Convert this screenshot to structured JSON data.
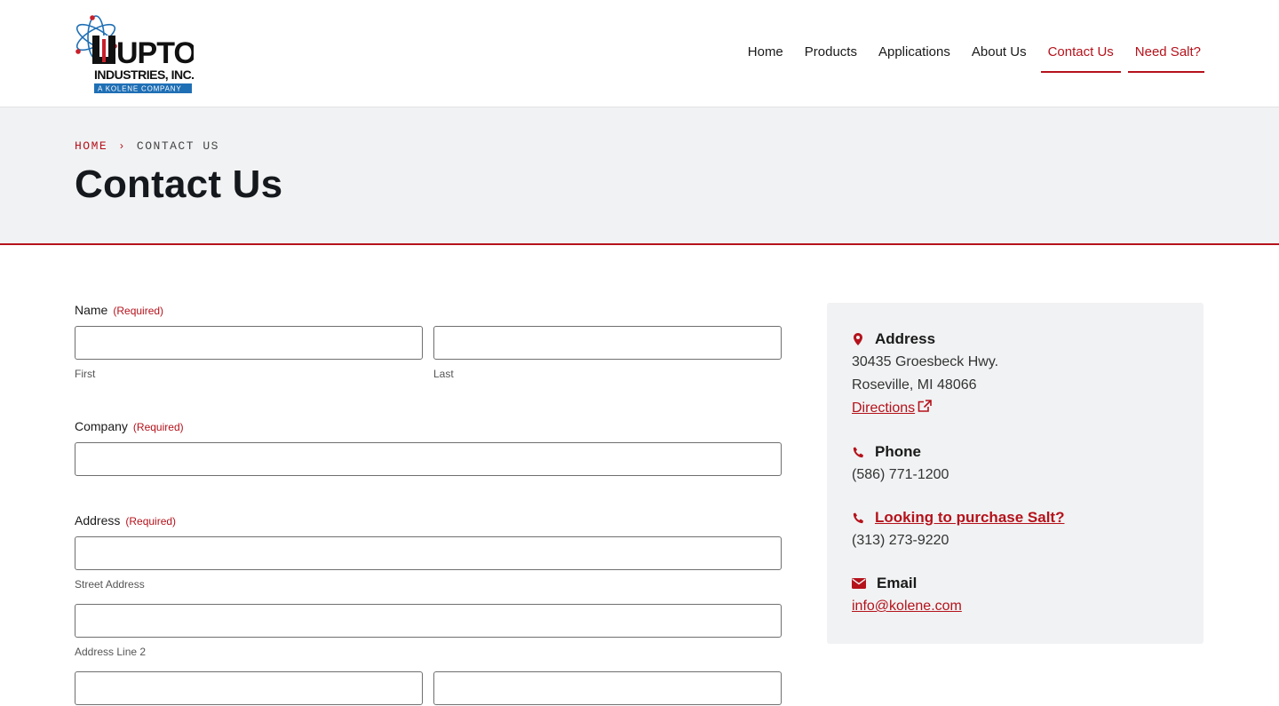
{
  "logo": {
    "text_main": "UPTON",
    "text_sub": "INDUSTRIES, INC.",
    "text_tag": "A KOLENE COMPANY"
  },
  "nav": [
    {
      "label": "Home"
    },
    {
      "label": "Products"
    },
    {
      "label": "Applications"
    },
    {
      "label": "About Us"
    },
    {
      "label": "Contact Us"
    },
    {
      "label": "Need Salt?"
    }
  ],
  "breadcrumb": {
    "home": "HOME",
    "separator": "›",
    "current": "CONTACT US"
  },
  "page_title": "Contact Us",
  "form": {
    "required_text": "(Required)",
    "name": {
      "label": "Name",
      "first_sub": "First",
      "last_sub": "Last"
    },
    "company": {
      "label": "Company"
    },
    "address": {
      "label": "Address",
      "street_sub": "Street Address",
      "line2_sub": "Address Line 2"
    }
  },
  "contact": {
    "address": {
      "heading": "Address",
      "line1": "30435 Groesbeck Hwy.",
      "line2": "Roseville, MI 48066",
      "directions": "Directions"
    },
    "phone": {
      "heading": "Phone",
      "number": "(586) 771-1200"
    },
    "salt": {
      "heading": "Looking to purchase Salt?",
      "number": "(313) 273-9220"
    },
    "email": {
      "heading": "Email",
      "address": "info@kolene.com"
    }
  },
  "colors": {
    "accent": "#b5121b",
    "hero_bg": "#f1f2f3",
    "logo_blue": "#1f6fb5"
  }
}
